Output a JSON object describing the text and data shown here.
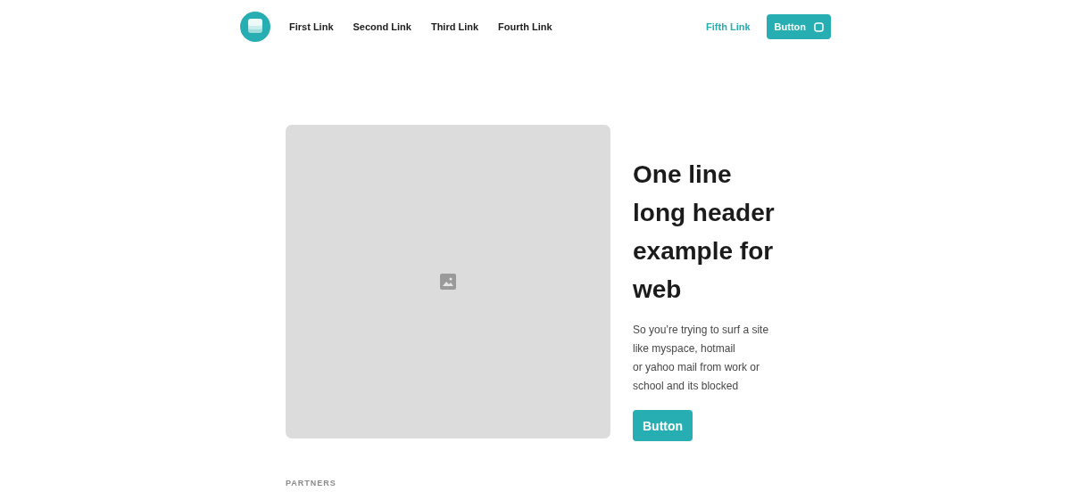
{
  "nav": {
    "links": [
      {
        "label": "First Link"
      },
      {
        "label": "Second Link"
      },
      {
        "label": "Third Link"
      },
      {
        "label": "Fourth Link"
      }
    ],
    "right_link": {
      "label": "Fifth Link"
    },
    "button": {
      "label": "Button"
    }
  },
  "hero": {
    "heading": "One line long header example for web",
    "body": "So you’re trying to surf a site like myspace, hotmail\nor yahoo mail from work or\nschool and its blocked",
    "button": {
      "label": "Button"
    }
  },
  "partners": {
    "label": "PARTNERS"
  }
}
